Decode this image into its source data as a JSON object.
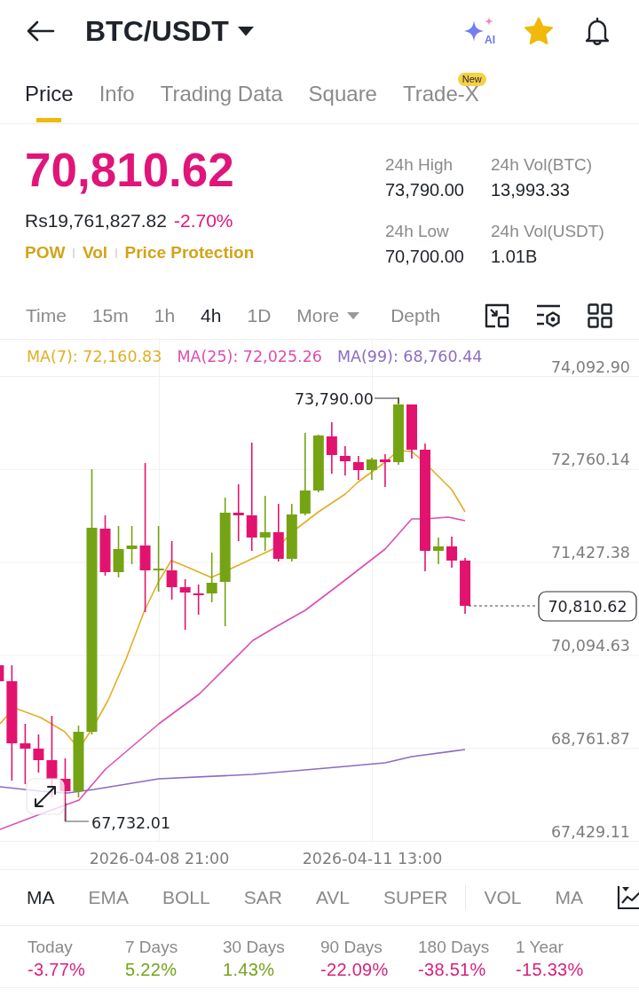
{
  "header": {
    "title": "BTC/USDT",
    "ai_label": "AI",
    "favorited": true
  },
  "tabs": [
    {
      "label": "Price",
      "selected": true
    },
    {
      "label": "Info",
      "selected": false
    },
    {
      "label": "Trading Data",
      "selected": false
    },
    {
      "label": "Square",
      "selected": false
    },
    {
      "label": "Trade-X",
      "selected": false,
      "badge": "New"
    }
  ],
  "price": {
    "last": "70,810.62",
    "falling": true,
    "fiat": "Rs19,761,827.82",
    "change": "-2.70%",
    "tags": [
      "POW",
      "Vol",
      "Price Protection"
    ]
  },
  "stats": [
    {
      "label": "24h High",
      "value": "73,790.00"
    },
    {
      "label": "24h Vol(BTC)",
      "value": "13,993.33"
    },
    {
      "label": "24h Low",
      "value": "70,700.00"
    },
    {
      "label": "24h Vol(USDT)",
      "value": "1.01B"
    }
  ],
  "intervals": [
    {
      "label": "Time",
      "kind": "interval",
      "selected": false
    },
    {
      "label": "15m",
      "kind": "interval",
      "selected": false
    },
    {
      "label": "1h",
      "kind": "interval",
      "selected": false
    },
    {
      "label": "4h",
      "kind": "interval",
      "selected": true
    },
    {
      "label": "1D",
      "kind": "interval",
      "selected": false
    },
    {
      "label": "More",
      "kind": "dropdown",
      "selected": false
    }
  ],
  "depth": {
    "label": "Depth",
    "selected": false
  },
  "chart": {
    "legend": [
      {
        "label": "MA(7): 72,160.83",
        "color": "#e2ae24"
      },
      {
        "label": "MA(25): 72,025.26",
        "color": "#dc4fb2"
      },
      {
        "label": "MA(99): 68,760.44",
        "color": "#8c6cc0"
      }
    ],
    "y_axis_labels": [
      "74,092.90",
      "72,760.14",
      "71,427.38",
      "70,094.63",
      "68,761.87",
      "67,429.11"
    ],
    "x_axis_labels": [
      "2026-04-08 21:00",
      "2026-04-11 13:00"
    ],
    "high_label": "73,790.00",
    "low_label": "67,732.01",
    "price_tag": "70,810.62"
  },
  "main_indicators": [
    {
      "label": "MA",
      "selected": true
    },
    {
      "label": "EMA",
      "selected": false
    },
    {
      "label": "BOLL",
      "selected": false
    },
    {
      "label": "SAR",
      "selected": false
    },
    {
      "label": "AVL",
      "selected": false
    },
    {
      "label": "SUPER",
      "selected": false
    }
  ],
  "sub_indicators": [
    {
      "label": "VOL",
      "selected": false
    },
    {
      "label": "MA",
      "selected": false
    }
  ],
  "performance": [
    {
      "period": "Today",
      "change": "-3.77%",
      "color": "#d9217c"
    },
    {
      "period": "7 Days",
      "change": "5.22%",
      "color": "#74a31a"
    },
    {
      "period": "30 Days",
      "change": "1.43%",
      "color": "#74a31a"
    },
    {
      "period": "90 Days",
      "change": "-22.09%",
      "color": "#d9217c"
    },
    {
      "period": "180 Days",
      "change": "-38.51%",
      "color": "#d9217c"
    },
    {
      "period": "1 Year",
      "change": "-15.33%",
      "color": "#d9217c"
    }
  ]
}
